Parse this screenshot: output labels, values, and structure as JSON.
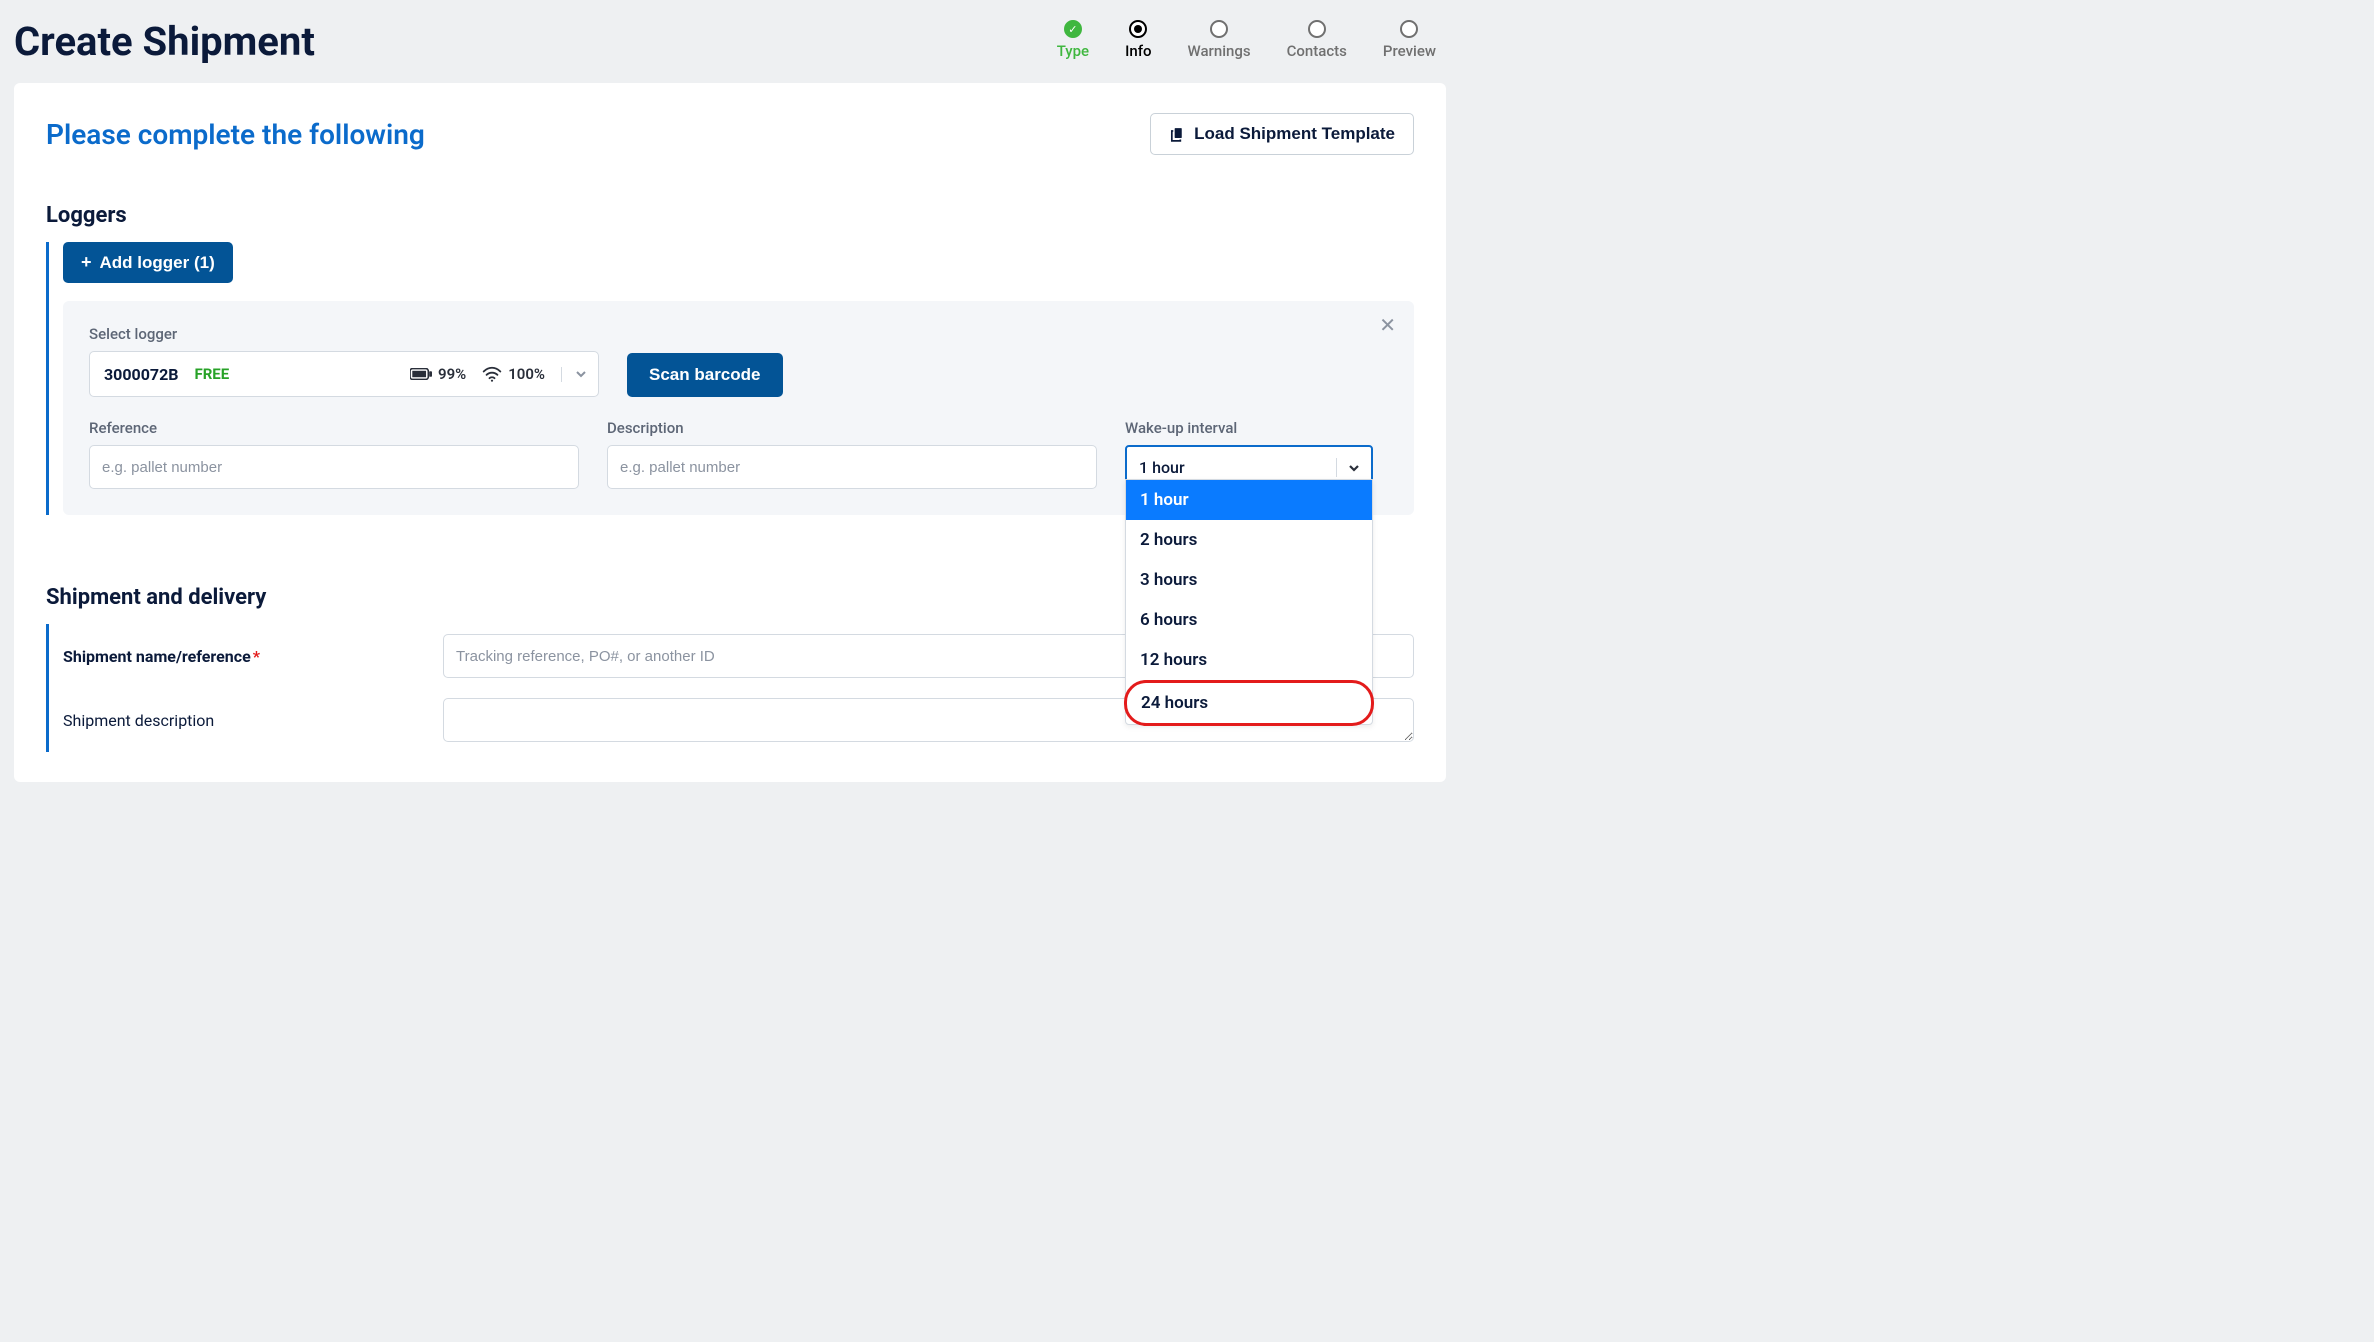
{
  "page_title": "Create Shipment",
  "steps": [
    {
      "label": "Type",
      "state": "done"
    },
    {
      "label": "Info",
      "state": "active"
    },
    {
      "label": "Warnings",
      "state": "pending"
    },
    {
      "label": "Contacts",
      "state": "pending"
    },
    {
      "label": "Preview",
      "state": "pending"
    }
  ],
  "card_title": "Please complete the following",
  "template_button_label": "Load Shipment Template",
  "loggers": {
    "section_title": "Loggers",
    "add_button_label": "Add logger (1)",
    "select_label": "Select logger",
    "selected_device_id": "3000072B",
    "status_text": "FREE",
    "battery_text": "99%",
    "signal_text": "100%",
    "scan_button_label": "Scan barcode",
    "reference_label": "Reference",
    "reference_placeholder": "e.g. pallet number",
    "description_label": "Description",
    "description_placeholder": "e.g. pallet number",
    "wakeup_label": "Wake-up interval",
    "wakeup_selected": "1 hour",
    "wakeup_options": [
      "1 hour",
      "2 hours",
      "3 hours",
      "6 hours",
      "12 hours",
      "24 hours"
    ]
  },
  "shipment": {
    "section_title": "Shipment and delivery",
    "name_label": "Shipment name/reference",
    "name_placeholder": "Tracking reference, PO#, or another ID",
    "desc_label": "Shipment description"
  },
  "annotations": {
    "highlighted_option": "24 hours"
  }
}
